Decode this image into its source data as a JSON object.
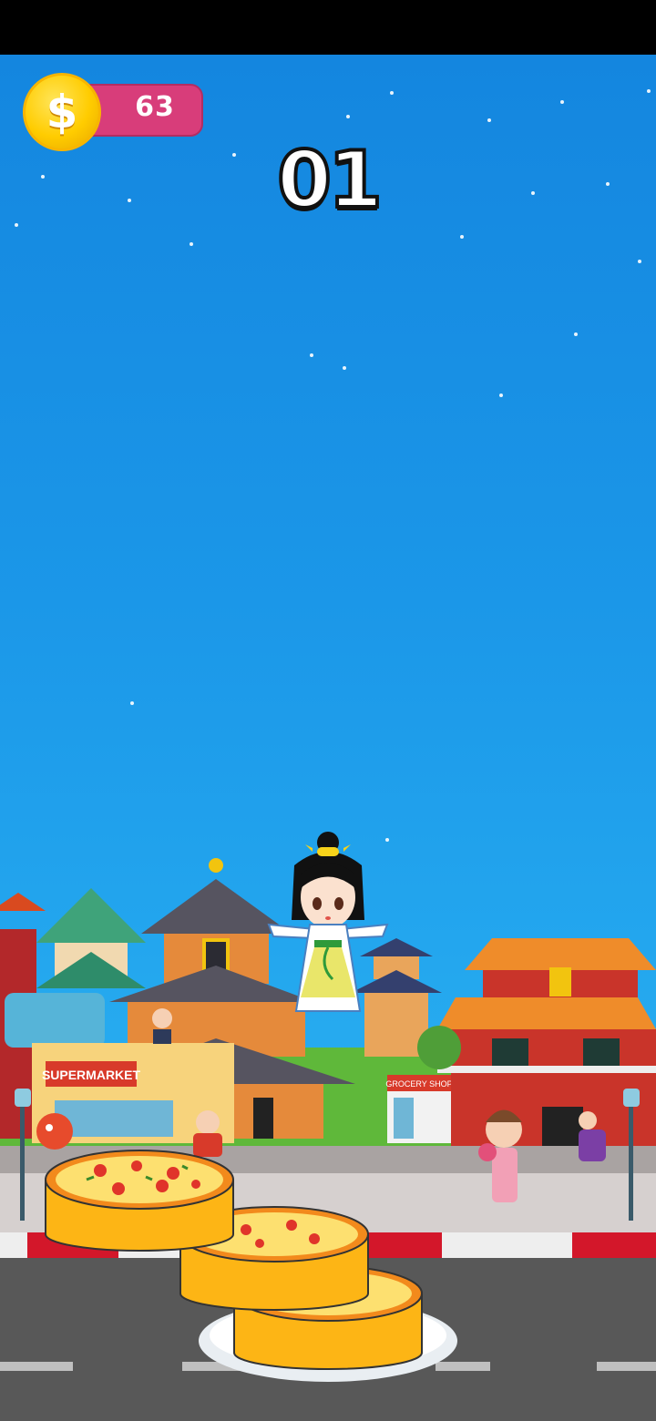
{
  "hud": {
    "coins": "63",
    "score": "01",
    "coin_icon": "dollar-coin-icon"
  },
  "signs": {
    "supermarket": "SUPERMARKET",
    "grocery": "GROCERY SHOP"
  },
  "colors": {
    "sky_top": "#1486df",
    "sky_bottom": "#2bb3f0",
    "coin_pill": "#d83d7a",
    "pizza_crust": "#fdb515"
  }
}
